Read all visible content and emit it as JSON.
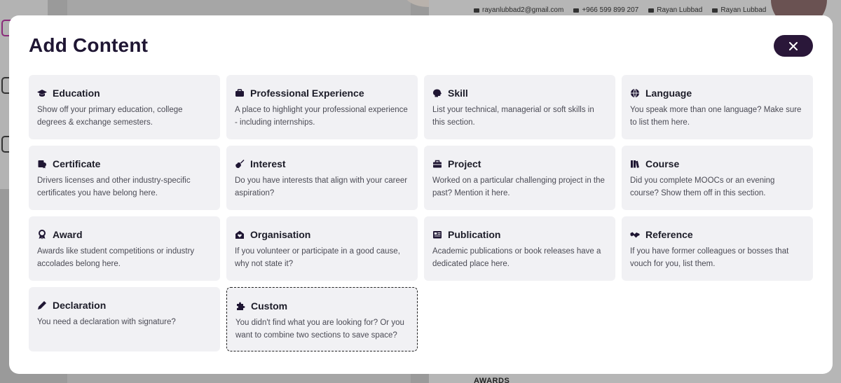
{
  "background": {
    "contact": {
      "email": "rayanlubbad2@gmail.com",
      "phone": "+966 599 899 207",
      "linkedin": "Rayan Lubbad",
      "twitter": "Rayan Lubbad"
    },
    "section_heading": "AWARDS"
  },
  "modal": {
    "title": "Add Content",
    "close_icon": "close-icon",
    "sections": [
      {
        "title": "Education",
        "icon": "graduation-cap-icon",
        "desc": "Show off your primary education, college degrees & exchange semesters."
      },
      {
        "title": "Professional Experience",
        "icon": "briefcase-icon",
        "desc": "A place to highlight your professional experience - including internships."
      },
      {
        "title": "Skill",
        "icon": "brain-icon",
        "desc": "List your technical, managerial or soft skills in this section."
      },
      {
        "title": "Language",
        "icon": "globe-icon",
        "desc": "You speak more than one language? Make sure to list them here."
      },
      {
        "title": "Certificate",
        "icon": "certificate-icon",
        "desc": "Drivers licenses and other industry-specific certificates you have belong here."
      },
      {
        "title": "Interest",
        "icon": "guitar-icon",
        "desc": "Do you have interests that align with your career aspiration?"
      },
      {
        "title": "Project",
        "icon": "toolbox-icon",
        "desc": "Worked on a particular challenging project in the past? Mention it here."
      },
      {
        "title": "Course",
        "icon": "books-icon",
        "desc": "Did you complete MOOCs or an evening course? Show them off in this section."
      },
      {
        "title": "Award",
        "icon": "medal-icon",
        "desc": "Awards like student competitions or industry accolades belong here."
      },
      {
        "title": "Organisation",
        "icon": "hands-heart-icon",
        "desc": "If you volunteer or participate in a good cause, why not state it?"
      },
      {
        "title": "Publication",
        "icon": "newspaper-icon",
        "desc": "Academic publications or book releases have a dedicated place here."
      },
      {
        "title": "Reference",
        "icon": "handshake-icon",
        "desc": "If you have former colleagues or bosses that vouch for you, list them."
      },
      {
        "title": "Declaration",
        "icon": "pen-icon",
        "desc": "You need a declaration with signature?"
      },
      {
        "title": "Custom",
        "icon": "puzzle-icon",
        "desc": "You didn't find what you are looking for? Or you want to combine two sections to save space?"
      }
    ]
  }
}
